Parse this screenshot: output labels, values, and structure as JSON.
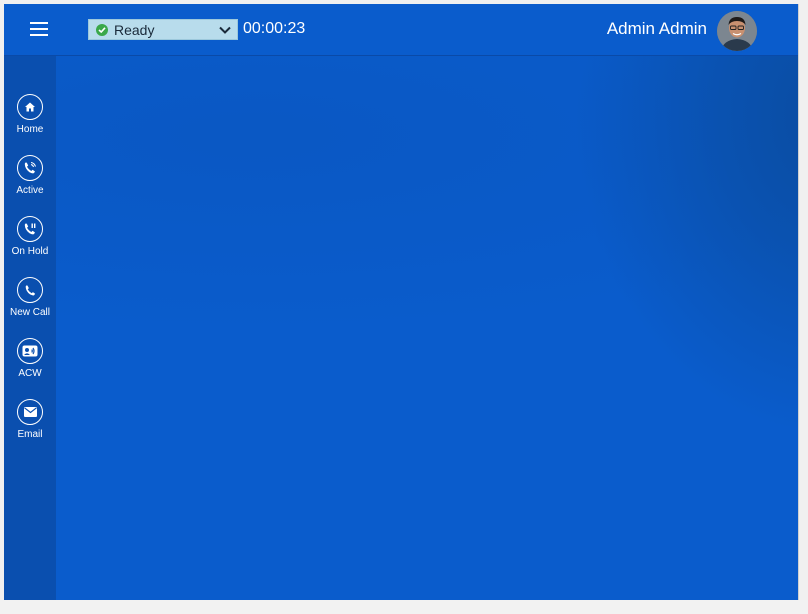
{
  "header": {
    "status": {
      "label": "Ready",
      "icon": "check-circle-icon",
      "color": "#3aa84a"
    },
    "timer": "00:00:23",
    "user_name": "Admin Admin"
  },
  "sidebar": {
    "items": [
      {
        "label": "Home",
        "icon": "home-icon"
      },
      {
        "label": "Active",
        "icon": "phone-active-icon"
      },
      {
        "label": "On Hold",
        "icon": "phone-hold-icon"
      },
      {
        "label": "New Call",
        "icon": "phone-icon"
      },
      {
        "label": "ACW",
        "icon": "contact-card-icon"
      },
      {
        "label": "Email",
        "icon": "envelope-icon"
      }
    ]
  },
  "theme": {
    "primary": "#0a5ccc",
    "sidebar": "#0a4faf",
    "status_bg": "#b8dcec"
  }
}
